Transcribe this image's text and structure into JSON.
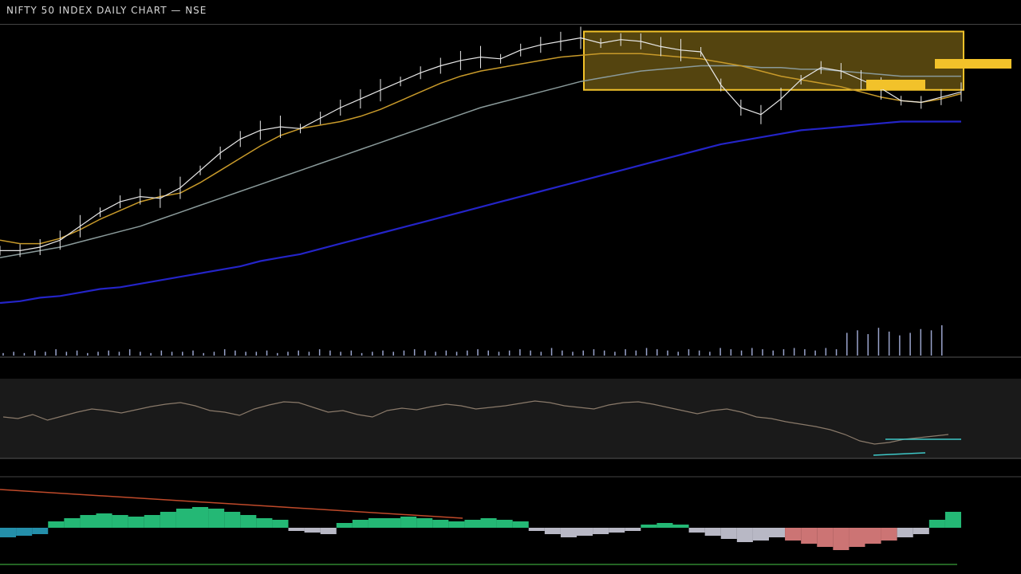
{
  "header": {
    "title": "NIFTY 50 INDEX DAILY CHART — NSE"
  },
  "colors": {
    "background": "#000000",
    "price": "#e8e8e8",
    "ma_fast": "#c89a2a",
    "ma_mid": "#8a9a9a",
    "ma_slow": "#2424c8",
    "zone": "#f2c22a",
    "volume": "#9aa4cc",
    "rsi": "#8a7a6a",
    "rsi_recent": "#3ec8c8",
    "macd_pos": "#2ad88a",
    "macd_neg_light": "#d8d8e8",
    "macd_neg_red": "#f08888",
    "macd_trend": "#c04a2a",
    "macd_signal": "#3aa03a"
  },
  "chart_data": [
    {
      "type": "line",
      "panel": "price",
      "x": [
        0,
        5,
        10,
        15,
        20,
        25,
        30,
        35,
        40,
        45,
        50,
        55,
        60,
        65,
        70,
        75,
        80,
        85,
        90,
        95,
        100,
        105,
        110,
        115,
        120,
        125,
        130,
        135,
        140,
        145,
        150,
        155,
        160,
        165,
        170,
        175,
        180,
        185,
        190,
        195,
        200,
        205,
        210,
        215,
        220,
        225,
        230,
        235,
        240
      ],
      "series": [
        {
          "key": "price",
          "values": [
            30,
            30,
            32,
            36,
            44,
            52,
            58,
            61,
            60,
            66,
            76,
            86,
            94,
            99,
            101,
            100,
            106,
            112,
            117,
            122,
            127,
            132,
            136,
            139,
            141,
            140,
            145,
            148,
            150,
            152,
            149,
            151,
            150,
            147,
            145,
            144,
            125,
            112,
            108,
            117,
            128,
            135,
            133,
            128,
            123,
            116,
            115,
            118,
            121
          ]
        },
        {
          "key": "ma_fast",
          "values": [
            36,
            34,
            34,
            37,
            42,
            48,
            53,
            58,
            61,
            63,
            69,
            76,
            83,
            90,
            96,
            100,
            102,
            104,
            107,
            111,
            116,
            121,
            126,
            130,
            133,
            135,
            137,
            139,
            141,
            142,
            143,
            143,
            143,
            142,
            141,
            140,
            138,
            136,
            133,
            130,
            128,
            126,
            124,
            121,
            118,
            116,
            115,
            117,
            120
          ]
        },
        {
          "key": "ma_mid",
          "values": [
            26,
            28,
            30,
            32,
            35,
            38,
            41,
            44,
            48,
            52,
            56,
            60,
            64,
            68,
            72,
            76,
            80,
            84,
            88,
            92,
            96,
            100,
            104,
            108,
            112,
            115,
            118,
            121,
            124,
            127,
            129,
            131,
            133,
            134,
            135,
            136,
            136,
            136,
            135,
            135,
            134,
            134,
            133,
            132,
            131,
            130,
            130,
            130,
            130
          ]
        },
        {
          "key": "ma_slow",
          "values": [
            0,
            1,
            3,
            4,
            6,
            8,
            9,
            11,
            13,
            15,
            17,
            19,
            21,
            24,
            26,
            28,
            31,
            34,
            37,
            40,
            43,
            46,
            49,
            52,
            55,
            58,
            61,
            64,
            67,
            70,
            73,
            76,
            79,
            82,
            85,
            88,
            91,
            93,
            95,
            97,
            99,
            100,
            101,
            102,
            103,
            104,
            104,
            104,
            104
          ]
        }
      ],
      "annotations": [
        {
          "kind": "zone",
          "y_range": [
            124,
            152
          ]
        },
        {
          "kind": "label",
          "text": "",
          "y": 128
        },
        {
          "kind": "label",
          "text": "",
          "y": 140
        }
      ]
    },
    {
      "type": "bar",
      "panel": "volume",
      "values": [
        2,
        3,
        2,
        4,
        3,
        5,
        3,
        4,
        2,
        3,
        4,
        3,
        5,
        3,
        2,
        4,
        3,
        3,
        4,
        2,
        3,
        5,
        4,
        3,
        3,
        4,
        2,
        3,
        4,
        3,
        5,
        4,
        3,
        4,
        2,
        3,
        4,
        3,
        4,
        5,
        4,
        3,
        4,
        3,
        4,
        5,
        4,
        3,
        4,
        5,
        4,
        3,
        6,
        4,
        3,
        4,
        5,
        4,
        3,
        5,
        4,
        6,
        5,
        4,
        3,
        5,
        4,
        3,
        6,
        5,
        4,
        6,
        5,
        4,
        5,
        6,
        5,
        4,
        6,
        5,
        18,
        20,
        17,
        22,
        19,
        16,
        18,
        21,
        20,
        24
      ]
    },
    {
      "type": "line",
      "panel": "rsi",
      "values": [
        52,
        50,
        55,
        48,
        53,
        58,
        62,
        60,
        57,
        61,
        65,
        68,
        70,
        66,
        60,
        58,
        54,
        62,
        67,
        71,
        70,
        64,
        58,
        60,
        55,
        52,
        60,
        63,
        61,
        65,
        68,
        66,
        62,
        64,
        66,
        69,
        72,
        70,
        66,
        64,
        62,
        67,
        70,
        71,
        68,
        64,
        60,
        56,
        60,
        62,
        58,
        52,
        50,
        46,
        43,
        40,
        36,
        30,
        22,
        18,
        20,
        24,
        26,
        28,
        30
      ]
    },
    {
      "type": "bar",
      "panel": "macd",
      "values": [
        -6,
        -5,
        -4,
        4,
        6,
        8,
        9,
        8,
        7,
        8,
        10,
        12,
        13,
        12,
        10,
        8,
        6,
        5,
        -2,
        -3,
        -4,
        3,
        5,
        6,
        6,
        7,
        6,
        5,
        4,
        5,
        6,
        5,
        4,
        -2,
        -4,
        -6,
        -5,
        -4,
        -3,
        -2,
        2,
        3,
        2,
        -3,
        -5,
        -7,
        -9,
        -8,
        -6,
        -8,
        -10,
        -12,
        -14,
        -12,
        -10,
        -8,
        -6,
        -4,
        5,
        10
      ]
    }
  ]
}
